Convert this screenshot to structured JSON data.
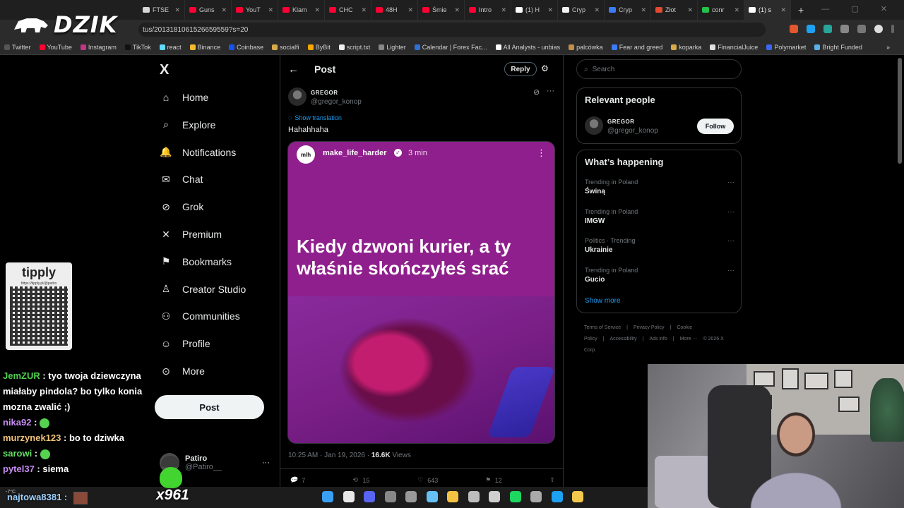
{
  "browser": {
    "tabs": [
      {
        "label": "FTSE",
        "color": "#d6d6d6"
      },
      {
        "label": "Guns",
        "color": "#ff0033"
      },
      {
        "label": "YouT",
        "color": "#ff0033"
      },
      {
        "label": "Klam",
        "color": "#ff0033"
      },
      {
        "label": "CHC",
        "color": "#ff0033"
      },
      {
        "label": "48H",
        "color": "#ff0033"
      },
      {
        "label": "Śmie",
        "color": "#ff0033"
      },
      {
        "label": "Intro",
        "color": "#ff0033"
      },
      {
        "label": "(1) H",
        "color": "#ffffff"
      },
      {
        "label": "Cryp",
        "color": "#f2f2f2"
      },
      {
        "label": "Cryp",
        "color": "#3b7bf6"
      },
      {
        "label": "Złot",
        "color": "#e24a2f"
      },
      {
        "label": "conr",
        "color": "#24c24a"
      },
      {
        "label": "(1) s",
        "color": "#ffffff"
      }
    ],
    "new_tab": "+",
    "url": "tus/2013181061526659559?s=20",
    "bookmarks": [
      "Twitter",
      "YouTube",
      "Instagram",
      "TikTok",
      "react",
      "Binance",
      "Coinbase",
      "socialfi",
      "ByBit",
      "script.txt",
      "Lighter",
      "Calendar | Forex Fac...",
      "All Analysts - unbias",
      "palcówka",
      "Fear and greed",
      "koparka",
      "FinancialJuice",
      "Polymarket",
      "Bright Funded"
    ],
    "bookmarks_more": "»"
  },
  "overlay": {
    "logo_text": "DZIK",
    "tipply_title": "tipply",
    "tipply_url": "https://tipply.pl/@patiro",
    "chat": [
      {
        "user": "JemZUR",
        "msg": ": tyo twoja dziewczyna miałaby pindola? bo tylko konia mozna zwalić ;)"
      },
      {
        "user": "nika92",
        "msg": ":"
      },
      {
        "user": "murzynek123",
        "msg": ": bo to dziwka"
      },
      {
        "user": "sarowi",
        "msg": ":"
      },
      {
        "user": "pytel37",
        "msg": ": siema"
      },
      {
        "user": "najtowa8381",
        "msg": ":"
      }
    ],
    "weather": "-7°C",
    "sub_count": "x961"
  },
  "nav": {
    "logo": "X",
    "items": [
      {
        "label": "Home",
        "icon": "home-icon"
      },
      {
        "label": "Explore",
        "icon": "search-icon"
      },
      {
        "label": "Notifications",
        "icon": "bell-icon"
      },
      {
        "label": "Chat",
        "icon": "mail-icon"
      },
      {
        "label": "Grok",
        "icon": "grok-icon"
      },
      {
        "label": "Premium",
        "icon": "x-premium-icon"
      },
      {
        "label": "Bookmarks",
        "icon": "bookmark-icon"
      },
      {
        "label": "Creator Studio",
        "icon": "creator-icon"
      },
      {
        "label": "Communities",
        "icon": "communities-icon"
      },
      {
        "label": "Profile",
        "icon": "profile-icon"
      },
      {
        "label": "More",
        "icon": "more-circle-icon"
      }
    ],
    "post_label": "Post",
    "account": {
      "name": "Patiro",
      "handle": "@Patiro__"
    },
    "account_more": "···"
  },
  "post": {
    "header_title": "Post",
    "reply_label": "Reply",
    "author_name": "GREGOR",
    "author_handle": "@gregor_konop",
    "show_translation": "Show translation",
    "text": "Hahahhaha",
    "embed": {
      "avatar_text": "mlh",
      "name": "make_life_harder",
      "time": "3 min",
      "caption": "Kiedy dzwoni kurier, a ty właśnie skończyłeś srać"
    },
    "time": "10:25 AM · Jan 19, 2026 · ",
    "views": "16.6K",
    "views_label": " Views",
    "stats": {
      "replies": "7",
      "reposts": "15",
      "likes": "643",
      "bookmarks": "12"
    }
  },
  "right": {
    "search_placeholder": "Search",
    "relevant_title": "Relevant people",
    "relevant": {
      "name": "GREGOR",
      "handle": "@gregor_konop",
      "follow": "Follow"
    },
    "happening_title": "What’s happening",
    "trends": [
      {
        "context": "Trending in Poland",
        "name": "Świną"
      },
      {
        "context": "Trending in Poland",
        "name": "IMGW"
      },
      {
        "context": "Politics · Trending",
        "name": "Ukrainie"
      },
      {
        "context": "Trending in Poland",
        "name": "Gucio"
      }
    ],
    "show_more": "Show more",
    "footer": [
      "Terms of Service",
      "|",
      "Privacy Policy",
      "|",
      "Cookie Policy",
      "|",
      "Accessibility",
      "|",
      "Ads info",
      "|",
      "More ···",
      "© 2026 X Corp."
    ]
  }
}
